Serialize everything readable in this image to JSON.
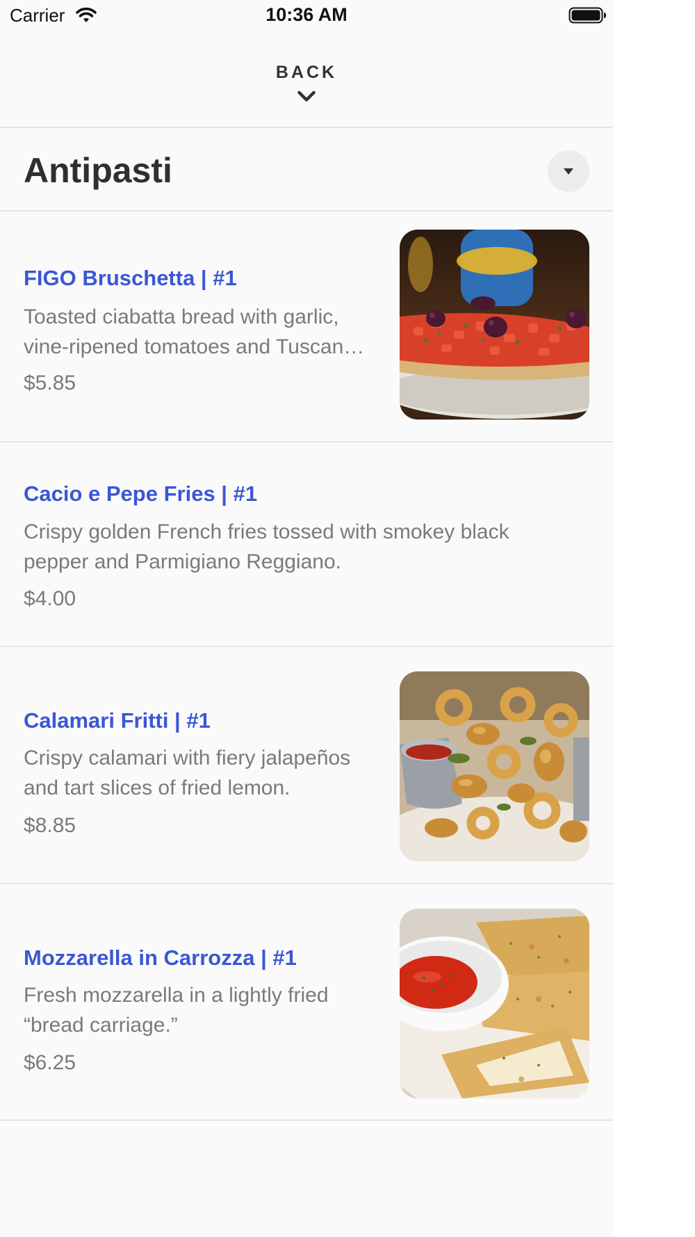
{
  "status_bar": {
    "carrier": "Carrier",
    "time": "10:36 AM"
  },
  "header": {
    "back_label": "BACK"
  },
  "section": {
    "title": "Antipasti"
  },
  "items": [
    {
      "name": "FIGO Bruschetta | #1",
      "description": "Toasted ciabatta bread with garlic, vine-ripened tomatoes and Tuscan…",
      "price": "$5.85"
    },
    {
      "name": "Cacio e Pepe Fries | #1",
      "description": "Crispy golden French fries tossed with smokey black pepper and Parmigiano Reggiano.",
      "price": "$4.00"
    },
    {
      "name": "Calamari Fritti | #1",
      "description": "Crispy calamari with fiery jalapeños and tart slices of fried lemon.",
      "price": "$8.85"
    },
    {
      "name": "Mozzarella in Carrozza | #1",
      "description": "Fresh mozzarella in a lightly fried “bread carriage.”",
      "price": "$6.25"
    }
  ],
  "colors": {
    "item_name": "#3a57d4",
    "text_muted": "#7a7a7a",
    "title": "#2f2f2f",
    "divider": "#e4e4e4"
  }
}
